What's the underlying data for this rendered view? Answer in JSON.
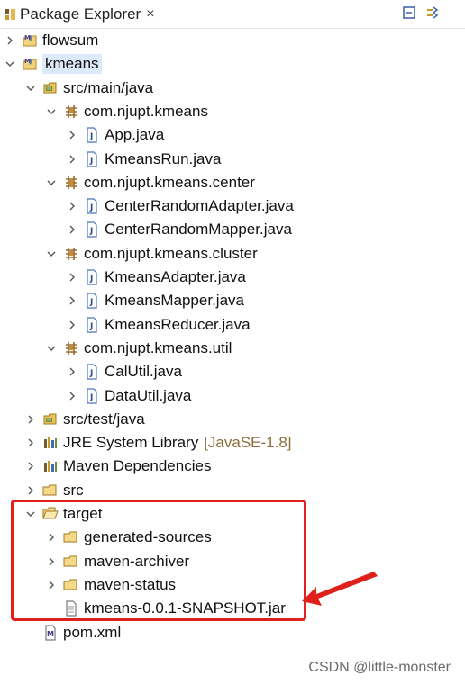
{
  "view": {
    "title": "Package Explorer",
    "close_glyph": "×",
    "toolbar": [
      {
        "name": "collapse-all-icon"
      },
      {
        "name": "link-with-editor-icon"
      }
    ]
  },
  "tree": [
    {
      "label": "flowsum",
      "icon": "maven-project-icon",
      "expanded": false,
      "level": 0
    },
    {
      "label": "kmeans",
      "icon": "maven-project-icon",
      "expanded": true,
      "level": 0,
      "selected": true
    },
    {
      "label": "src/main/java",
      "icon": "source-folder-icon",
      "expanded": true,
      "level": 1
    },
    {
      "label": "com.njupt.kmeans",
      "icon": "package-icon",
      "expanded": true,
      "level": 2
    },
    {
      "label": "App.java",
      "icon": "java-file-icon",
      "expanded": false,
      "level": 3
    },
    {
      "label": "KmeansRun.java",
      "icon": "java-file-icon",
      "expanded": false,
      "level": 3
    },
    {
      "label": "com.njupt.kmeans.center",
      "icon": "package-icon",
      "expanded": true,
      "level": 2
    },
    {
      "label": "CenterRandomAdapter.java",
      "icon": "java-file-icon",
      "expanded": false,
      "level": 3
    },
    {
      "label": "CenterRandomMapper.java",
      "icon": "java-file-icon",
      "expanded": false,
      "level": 3
    },
    {
      "label": "com.njupt.kmeans.cluster",
      "icon": "package-icon",
      "expanded": true,
      "level": 2
    },
    {
      "label": "KmeansAdapter.java",
      "icon": "java-file-icon",
      "expanded": false,
      "level": 3
    },
    {
      "label": "KmeansMapper.java",
      "icon": "java-file-icon",
      "expanded": false,
      "level": 3
    },
    {
      "label": "KmeansReducer.java",
      "icon": "java-file-icon",
      "expanded": false,
      "level": 3
    },
    {
      "label": "com.njupt.kmeans.util",
      "icon": "package-icon",
      "expanded": true,
      "level": 2
    },
    {
      "label": "CalUtil.java",
      "icon": "java-file-icon",
      "expanded": false,
      "level": 3
    },
    {
      "label": "DataUtil.java",
      "icon": "java-file-icon",
      "expanded": false,
      "level": 3
    },
    {
      "label": "src/test/java",
      "icon": "source-folder-icon",
      "expanded": false,
      "level": 1
    },
    {
      "label": "JRE System Library",
      "decoration": "[JavaSE-1.8]",
      "icon": "library-icon",
      "expanded": false,
      "level": 1
    },
    {
      "label": "Maven Dependencies",
      "icon": "library-icon",
      "expanded": false,
      "level": 1
    },
    {
      "label": "src",
      "icon": "folder-icon",
      "expanded": false,
      "level": 1
    },
    {
      "label": "target",
      "icon": "folder-open-icon",
      "expanded": true,
      "level": 1
    },
    {
      "label": "generated-sources",
      "icon": "folder-icon",
      "expanded": false,
      "level": 2
    },
    {
      "label": "maven-archiver",
      "icon": "folder-icon",
      "expanded": false,
      "level": 2
    },
    {
      "label": "maven-status",
      "icon": "folder-icon",
      "expanded": false,
      "level": 2
    },
    {
      "label": "kmeans-0.0.1-SNAPSHOT.jar",
      "icon": "file-icon",
      "leaf": true,
      "level": 2
    },
    {
      "label": "pom.xml",
      "icon": "pom-file-icon",
      "leaf": true,
      "level": 1
    }
  ],
  "annotation": {
    "color": "#e0201a"
  },
  "watermark": "CSDN @little-monster"
}
